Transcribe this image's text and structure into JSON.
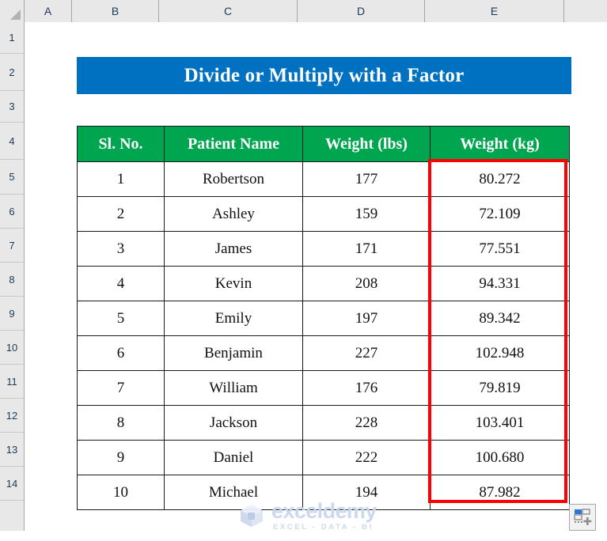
{
  "app": {
    "type": "spreadsheet",
    "select_all_label": "Select All"
  },
  "grid": {
    "column_headers": [
      "A",
      "B",
      "C",
      "D",
      "E"
    ],
    "row_headers": [
      "1",
      "2",
      "3",
      "4",
      "5",
      "6",
      "7",
      "8",
      "9",
      "10",
      "11",
      "12",
      "13",
      "14"
    ]
  },
  "banner": {
    "title": "Divide or Multiply with a Factor",
    "background_color": "#0070C0",
    "text_color": "#FFFFFF"
  },
  "table": {
    "header_background_color": "#00A550",
    "header_text_color": "#FFFFFF",
    "border_color": "#1A1A1A",
    "columns": [
      "Sl. No.",
      "Patient Name",
      "Weight (lbs)",
      "Weight (kg)"
    ],
    "rows": [
      [
        "1",
        "Robertson",
        "177",
        "80.272"
      ],
      [
        "2",
        "Ashley",
        "159",
        "72.109"
      ],
      [
        "3",
        "James",
        "171",
        "77.551"
      ],
      [
        "4",
        "Kevin",
        "208",
        "94.331"
      ],
      [
        "5",
        "Emily",
        "197",
        "89.342"
      ],
      [
        "6",
        "Benjamin",
        "227",
        "102.948"
      ],
      [
        "7",
        "William",
        "176",
        "79.819"
      ],
      [
        "8",
        "Jackson",
        "228",
        "103.401"
      ],
      [
        "9",
        "Daniel",
        "222",
        "100.680"
      ],
      [
        "10",
        "Michael",
        "194",
        "87.982"
      ]
    ]
  },
  "highlight": {
    "label": "Weight (kg) result column highlight",
    "color": "#FE0000",
    "target_column": "Weight (kg)"
  },
  "watermark": {
    "name": "exceldemy",
    "tagline": "EXCEL - DATA - BI",
    "color": "#C9D6EE"
  },
  "quick_analysis": {
    "label": "Quick Analysis",
    "accent_color": "#2E75D4"
  }
}
